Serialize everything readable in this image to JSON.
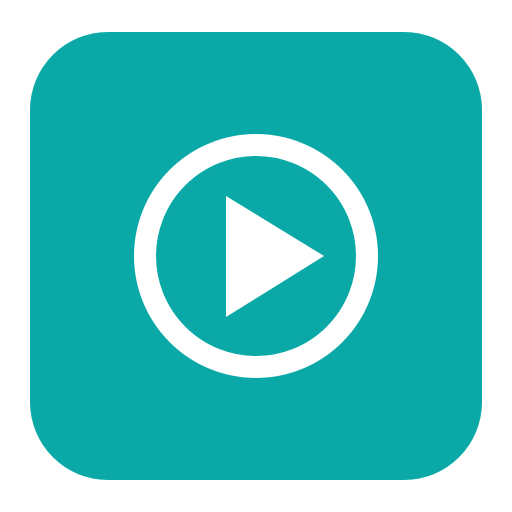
{
  "icon": {
    "name": "play-circle-icon",
    "tile_color": "#0aa9a8",
    "glyph_color": "#ffffff"
  }
}
